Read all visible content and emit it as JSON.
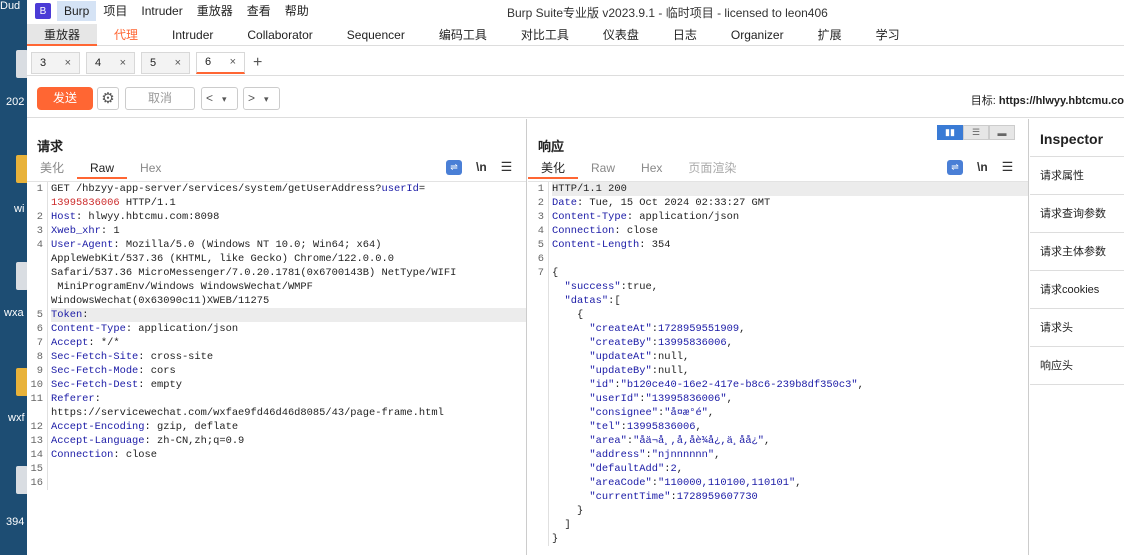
{
  "desktop": {
    "labels": [
      "Dud",
      "202",
      "wi",
      "wxa",
      "wxf",
      "394"
    ]
  },
  "menu": {
    "logo": "B",
    "items": [
      "Burp",
      "项目",
      "Intruder",
      "重放器",
      "查看",
      "帮助"
    ]
  },
  "window_title": "Burp Suite专业版  v2023.9.1 - 临时项目 - licensed to leon406",
  "main_tabs": [
    "重放器",
    "代理",
    "Intruder",
    "Collaborator",
    "Sequencer",
    "编码工具",
    "对比工具",
    "仪表盘",
    "日志",
    "Organizer",
    "扩展",
    "学习"
  ],
  "sub_tabs": [
    "3",
    "4",
    "5",
    "6"
  ],
  "sub_tab_close": "×",
  "add_tab": "+",
  "toolbar": {
    "send": "发送",
    "cancel": "取消",
    "prev": "<",
    "next": ">",
    "dropdown": "▾",
    "target_label": "目标:",
    "target_url": "https://hlwyy.hbtcmu.co"
  },
  "request": {
    "title": "请求",
    "tabs": [
      "美化",
      "Raw",
      "Hex"
    ],
    "icons": {
      "wrap": "wrap-icon",
      "newline": "\\n",
      "menu": "☰"
    },
    "lines": [
      {
        "n": "1",
        "segs": [
          {
            "t": "GET /hbzyy-app-server/services/system/getUserAddress?",
            "c": ""
          },
          {
            "t": "userId",
            "c": "k"
          },
          {
            "t": "=",
            "c": ""
          }
        ]
      },
      {
        "n": "",
        "segs": [
          {
            "t": "13995836006",
            "c": "r"
          },
          {
            "t": " HTTP/1.1",
            "c": ""
          }
        ]
      },
      {
        "n": "2",
        "segs": [
          {
            "t": "Host",
            "c": "k"
          },
          {
            "t": ": hlwyy.hbtcmu.com:8098",
            "c": ""
          }
        ]
      },
      {
        "n": "3",
        "segs": [
          {
            "t": "Xweb_xhr",
            "c": "k"
          },
          {
            "t": ": 1",
            "c": ""
          }
        ]
      },
      {
        "n": "4",
        "segs": [
          {
            "t": "User-Agent",
            "c": "k"
          },
          {
            "t": ": Mozilla/5.0 (Windows NT 10.0; Win64; x64)",
            "c": ""
          }
        ]
      },
      {
        "n": "",
        "segs": [
          {
            "t": "AppleWebKit/537.36 (KHTML, like Gecko) Chrome/122.0.0.0",
            "c": ""
          }
        ]
      },
      {
        "n": "",
        "segs": [
          {
            "t": "Safari/537.36 MicroMessenger/7.0.20.1781(0x6700143B) NetType/WIFI",
            "c": ""
          }
        ]
      },
      {
        "n": "",
        "segs": [
          {
            "t": " MiniProgramEnv/Windows WindowsWechat/WMPF",
            "c": ""
          }
        ]
      },
      {
        "n": "",
        "segs": [
          {
            "t": "WindowsWechat(0x63090c11)XWEB/11275",
            "c": ""
          }
        ]
      },
      {
        "n": "5",
        "segs": [
          {
            "t": "Token",
            "c": "k"
          },
          {
            "t": ":",
            "c": ""
          }
        ],
        "hl": true
      },
      {
        "n": "6",
        "segs": [
          {
            "t": "Content-Type",
            "c": "k"
          },
          {
            "t": ": application/json",
            "c": ""
          }
        ]
      },
      {
        "n": "7",
        "segs": [
          {
            "t": "Accept",
            "c": "k"
          },
          {
            "t": ": */*",
            "c": ""
          }
        ]
      },
      {
        "n": "8",
        "segs": [
          {
            "t": "Sec-Fetch-Site",
            "c": "k"
          },
          {
            "t": ": cross-site",
            "c": ""
          }
        ]
      },
      {
        "n": "9",
        "segs": [
          {
            "t": "Sec-Fetch-Mode",
            "c": "k"
          },
          {
            "t": ": cors",
            "c": ""
          }
        ]
      },
      {
        "n": "10",
        "segs": [
          {
            "t": "Sec-Fetch-Dest",
            "c": "k"
          },
          {
            "t": ": empty",
            "c": ""
          }
        ]
      },
      {
        "n": "11",
        "segs": [
          {
            "t": "Referer",
            "c": "k"
          },
          {
            "t": ":",
            "c": ""
          }
        ]
      },
      {
        "n": "",
        "segs": [
          {
            "t": "https://servicewechat.com/wxfae9fd46d46d8085/43/page-frame.html",
            "c": ""
          }
        ]
      },
      {
        "n": "12",
        "segs": [
          {
            "t": "Accept-Encoding",
            "c": "k"
          },
          {
            "t": ": gzip, deflate",
            "c": ""
          }
        ]
      },
      {
        "n": "13",
        "segs": [
          {
            "t": "Accept-Language",
            "c": "k"
          },
          {
            "t": ": zh-CN,zh;q=0.9",
            "c": ""
          }
        ]
      },
      {
        "n": "14",
        "segs": [
          {
            "t": "Connection",
            "c": "k"
          },
          {
            "t": ": close",
            "c": ""
          }
        ]
      },
      {
        "n": "15",
        "segs": []
      },
      {
        "n": "16",
        "segs": []
      }
    ]
  },
  "response": {
    "title": "响应",
    "tabs": [
      "美化",
      "Raw",
      "Hex",
      "页面渲染"
    ],
    "icons": {
      "wrap": "wrap-icon",
      "newline": "\\n",
      "menu": "☰"
    },
    "layout_buttons": [
      "▮▮",
      "☰",
      "▬"
    ],
    "lines": [
      {
        "n": "1",
        "segs": [
          {
            "t": "HTTP/1.1 200",
            "c": ""
          }
        ],
        "hl": true
      },
      {
        "n": "2",
        "segs": [
          {
            "t": "Date",
            "c": "k"
          },
          {
            "t": ": Tue, 15 Oct 2024 02:33:27 GMT",
            "c": ""
          }
        ]
      },
      {
        "n": "3",
        "segs": [
          {
            "t": "Content-Type",
            "c": "k"
          },
          {
            "t": ": application/json",
            "c": ""
          }
        ]
      },
      {
        "n": "4",
        "segs": [
          {
            "t": "Connection",
            "c": "k"
          },
          {
            "t": ": close",
            "c": ""
          }
        ]
      },
      {
        "n": "5",
        "segs": [
          {
            "t": "Content-Length",
            "c": "k"
          },
          {
            "t": ": 354",
            "c": ""
          }
        ]
      },
      {
        "n": "6",
        "segs": []
      },
      {
        "n": "7",
        "segs": [
          {
            "t": "{",
            "c": ""
          }
        ]
      },
      {
        "n": "",
        "segs": [
          {
            "t": "  \"success\"",
            "c": "k"
          },
          {
            "t": ":true,",
            "c": ""
          }
        ]
      },
      {
        "n": "",
        "segs": [
          {
            "t": "  \"datas\"",
            "c": "k"
          },
          {
            "t": ":[",
            "c": ""
          }
        ]
      },
      {
        "n": "",
        "segs": [
          {
            "t": "    {",
            "c": ""
          }
        ]
      },
      {
        "n": "",
        "segs": [
          {
            "t": "      \"createAt\"",
            "c": "k"
          },
          {
            "t": ":",
            "c": ""
          },
          {
            "t": "1728959551909",
            "c": "n"
          },
          {
            "t": ",",
            "c": ""
          }
        ]
      },
      {
        "n": "",
        "segs": [
          {
            "t": "      \"createBy\"",
            "c": "k"
          },
          {
            "t": ":",
            "c": ""
          },
          {
            "t": "13995836006",
            "c": "n"
          },
          {
            "t": ",",
            "c": ""
          }
        ]
      },
      {
        "n": "",
        "segs": [
          {
            "t": "      \"updateAt\"",
            "c": "k"
          },
          {
            "t": ":null,",
            "c": ""
          }
        ]
      },
      {
        "n": "",
        "segs": [
          {
            "t": "      \"updateBy\"",
            "c": "k"
          },
          {
            "t": ":null,",
            "c": ""
          }
        ]
      },
      {
        "n": "",
        "segs": [
          {
            "t": "      \"id\"",
            "c": "k"
          },
          {
            "t": ":",
            "c": ""
          },
          {
            "t": "\"b120ce40-16e2-417e-b8c6-239b8df350c3\"",
            "c": "s"
          },
          {
            "t": ",",
            "c": ""
          }
        ]
      },
      {
        "n": "",
        "segs": [
          {
            "t": "      \"userId\"",
            "c": "k"
          },
          {
            "t": ":",
            "c": ""
          },
          {
            "t": "\"13995836006\"",
            "c": "s"
          },
          {
            "t": ",",
            "c": ""
          }
        ]
      },
      {
        "n": "",
        "segs": [
          {
            "t": "      \"consignee\"",
            "c": "k"
          },
          {
            "t": ":",
            "c": ""
          },
          {
            "t": "\"å¤æ°é\"",
            "c": "s"
          },
          {
            "t": ",",
            "c": ""
          }
        ]
      },
      {
        "n": "",
        "segs": [
          {
            "t": "      \"tel\"",
            "c": "k"
          },
          {
            "t": ":",
            "c": ""
          },
          {
            "t": "13995836006",
            "c": "n"
          },
          {
            "t": ",",
            "c": ""
          }
        ]
      },
      {
        "n": "",
        "segs": [
          {
            "t": "      \"area\"",
            "c": "k"
          },
          {
            "t": ":",
            "c": ""
          },
          {
            "t": "\"åä¬å¸,å,åè¾å¿,ä¸åå¿\"",
            "c": "s"
          },
          {
            "t": ",",
            "c": ""
          }
        ]
      },
      {
        "n": "",
        "segs": [
          {
            "t": "      \"address\"",
            "c": "k"
          },
          {
            "t": ":",
            "c": ""
          },
          {
            "t": "\"njnnnnnn\"",
            "c": "s"
          },
          {
            "t": ",",
            "c": ""
          }
        ]
      },
      {
        "n": "",
        "segs": [
          {
            "t": "      \"defaultAdd\"",
            "c": "k"
          },
          {
            "t": ":",
            "c": ""
          },
          {
            "t": "2",
            "c": "n"
          },
          {
            "t": ",",
            "c": ""
          }
        ]
      },
      {
        "n": "",
        "segs": [
          {
            "t": "      \"areaCode\"",
            "c": "k"
          },
          {
            "t": ":",
            "c": ""
          },
          {
            "t": "\"110000,110100,110101\"",
            "c": "s"
          },
          {
            "t": ",",
            "c": ""
          }
        ]
      },
      {
        "n": "",
        "segs": [
          {
            "t": "      \"currentTime\"",
            "c": "k"
          },
          {
            "t": ":",
            "c": ""
          },
          {
            "t": "1728959607730",
            "c": "n"
          }
        ]
      },
      {
        "n": "",
        "segs": [
          {
            "t": "    }",
            "c": ""
          }
        ]
      },
      {
        "n": "",
        "segs": [
          {
            "t": "  ]",
            "c": ""
          }
        ]
      },
      {
        "n": "",
        "segs": [
          {
            "t": "}",
            "c": ""
          }
        ]
      }
    ]
  },
  "inspector": {
    "title": "Inspector",
    "items": [
      "请求属性",
      "请求查询参数",
      "请求主体参数",
      "请求cookies",
      "请求头",
      "响应头"
    ]
  }
}
